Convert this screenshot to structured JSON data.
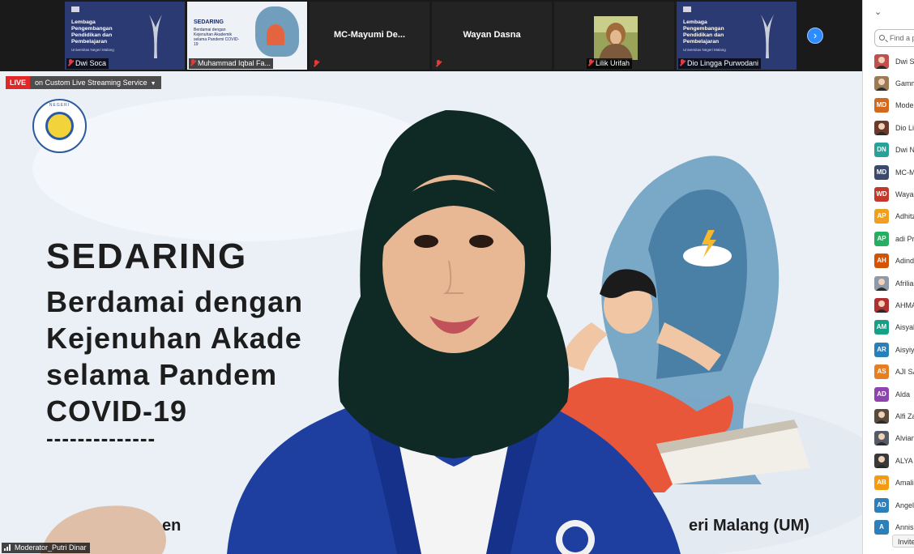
{
  "strip": {
    "tiles": [
      {
        "name": "Dwi Soca",
        "kind": "slide",
        "title": "Lembaga Pengembangan Pendidikan dan Pembelajaran",
        "sub": "Universitas Negeri Malang"
      },
      {
        "name": "Muhammad Iqbal Fa...",
        "kind": "slide2",
        "title": "SEDARING",
        "text": "Berdamai dengan Kejenuhan Akademik selama Pandemi COVID-19"
      },
      {
        "name": "MC-Mayumi De...",
        "kind": "named"
      },
      {
        "name": "Wayan Dasna",
        "kind": "named"
      },
      {
        "name": "Lilik Urifah",
        "kind": "video"
      },
      {
        "name": "Dio Lingga Purwodani",
        "kind": "slide",
        "title": "Lembaga Pengembangan Pendidikan dan Pembelajaran",
        "sub": "Universitas Negeri Malang"
      }
    ],
    "next_arrow": "›"
  },
  "main": {
    "live_badge": "LIVE",
    "live_service": "on Custom Live Streaming Service",
    "slide_title": "SEDARING",
    "slide_lines": [
      "Berdamai dengan",
      "Kejenuhan Akade",
      "selama Pandem",
      "COVID-19"
    ],
    "slide_dashes": "--------------",
    "footer_left": "en",
    "footer_right": "eri Malang (UM)",
    "speaker_label": "Moderator_Putri Dinar",
    "logo_text": "NEGERI"
  },
  "panel": {
    "collapse_icon": "⌄",
    "search_placeholder": "Find a p",
    "participants": [
      {
        "initials": "",
        "name": "Dwi So",
        "color": "#c0504d",
        "photo": true
      },
      {
        "initials": "",
        "name": "Gamm",
        "color": "#9b7b55",
        "photo": true
      },
      {
        "initials": "MD",
        "name": "Mode",
        "color": "#d2691e"
      },
      {
        "initials": "",
        "name": "Dio Lii",
        "color": "#6b3a2a",
        "photo": true
      },
      {
        "initials": "DN",
        "name": "Dwi N",
        "color": "#2aa198"
      },
      {
        "initials": "MD",
        "name": "MC-M",
        "color": "#3b4a6b"
      },
      {
        "initials": "WD",
        "name": "Wayar",
        "color": "#c0392b"
      },
      {
        "initials": "AP",
        "name": "Adhitz",
        "color": "#f0a020"
      },
      {
        "initials": "AP",
        "name": "adi Pr",
        "color": "#27ae60"
      },
      {
        "initials": "AH",
        "name": "Adind",
        "color": "#d35400"
      },
      {
        "initials": "",
        "name": "Afrilia",
        "color": "#8e9aa8",
        "photo": true
      },
      {
        "initials": "",
        "name": "AHMA",
        "color": "#b03030",
        "photo": true
      },
      {
        "initials": "AM",
        "name": "Aisyah",
        "color": "#16a085"
      },
      {
        "initials": "AR",
        "name": "Aisyiy",
        "color": "#2980b9"
      },
      {
        "initials": "AS",
        "name": "AJI SA",
        "color": "#e67e22"
      },
      {
        "initials": "AD",
        "name": "Alda",
        "color": "#8e44ad"
      },
      {
        "initials": "",
        "name": "Alfi Za",
        "color": "#5a4a3a",
        "photo": true
      },
      {
        "initials": "",
        "name": "Alvian",
        "color": "#555c66",
        "photo": true
      },
      {
        "initials": "",
        "name": "ALYA N",
        "color": "#3a3a3a",
        "photo": true
      },
      {
        "initials": "AB",
        "name": "Amalia",
        "color": "#f39c12"
      },
      {
        "initials": "AD",
        "name": "Angell",
        "color": "#2c7fb8"
      },
      {
        "initials": "A",
        "name": "Annisa",
        "color": "#2c7fb8"
      }
    ],
    "invite_label": "Invite"
  }
}
